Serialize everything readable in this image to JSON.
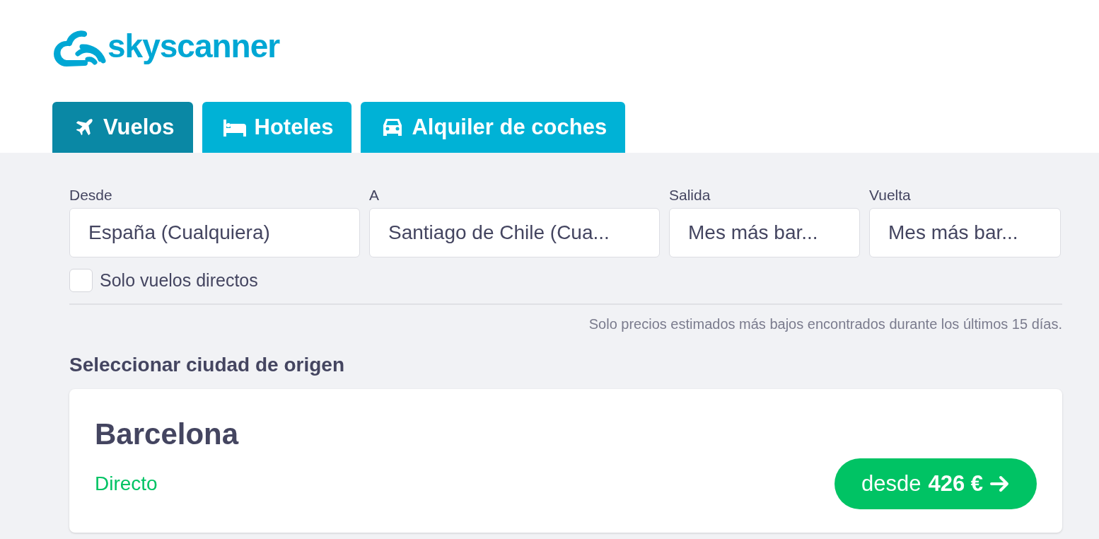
{
  "logo": {
    "text": "skyscanner"
  },
  "tabs": [
    {
      "label": "Vuelos",
      "kind": "plane",
      "selected": true
    },
    {
      "label": "Hoteles",
      "kind": "bed",
      "selected": false
    },
    {
      "label": "Alquiler de coches",
      "kind": "car",
      "selected": false
    }
  ],
  "fields": [
    {
      "label": "Desde",
      "value": "España (Cualquiera)"
    },
    {
      "label": "A",
      "value": "Santiago de Chile (Cua..."
    },
    {
      "label": "Salida",
      "value": "Mes más bar..."
    },
    {
      "label": "Vuelta",
      "value": "Mes más bar..."
    }
  ],
  "direct_only": {
    "label": "Solo vuelos directos",
    "checked": false
  },
  "note": "Solo precios estimados más bajos encontrados durante los últimos 15 días.",
  "section_title": "Seleccionar ciudad de origen",
  "results": [
    {
      "city": "Barcelona",
      "stops": "Directo",
      "price_prefix": "desde",
      "price": "426 €"
    }
  ]
}
